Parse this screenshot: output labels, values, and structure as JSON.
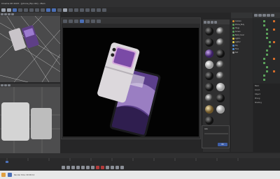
{
  "app": {
    "title": "Cinema 4D 2023 - [phone_flip.c4d] - Main"
  },
  "menubar": {
    "items": [
      "File",
      "Edit",
      "Create",
      "Modes",
      "Select",
      "Tools",
      "Mesh",
      "Spline",
      "Simulate",
      "Tracker",
      "Render",
      "Extensions",
      "Window",
      "Help"
    ]
  },
  "render_window": {
    "title": "Picture Viewer"
  },
  "materials": {
    "tabs": [
      "Create",
      "Edit",
      "View",
      "Select",
      "Material",
      "Texture"
    ]
  },
  "object_manager": {
    "rows": [
      "Camera",
      "Phone_Body",
      "Hinge",
      "Screen",
      "Back_Cover",
      "Light.1",
      "Light.2",
      "Sky",
      "Floor",
      "Null"
    ]
  },
  "attributes": {
    "rows": [
      "Basic",
      "Coord.",
      "Object",
      "Phong",
      "Shading"
    ]
  },
  "dialog": {
    "title": "Info",
    "ok": "OK"
  },
  "timeline": {
    "start": "0 F",
    "end": "90 F",
    "current": "0 F"
  },
  "statusbar": {
    "text": "Render time: 00:00:12"
  },
  "colors": {
    "accent": "#4b6fb6",
    "purple": "#6b4aa0",
    "render_bg": "#030303"
  }
}
